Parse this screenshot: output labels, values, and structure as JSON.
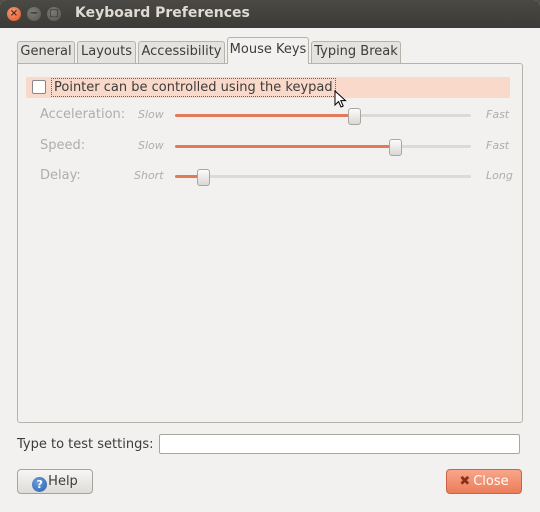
{
  "window": {
    "title": "Keyboard Preferences",
    "close_glyph": "×",
    "minimize_glyph": "−",
    "maximize_glyph": "□"
  },
  "tabs": [
    {
      "label": "General"
    },
    {
      "label": "Layouts"
    },
    {
      "label": "Accessibility"
    },
    {
      "label": "Mouse Keys",
      "active": true
    },
    {
      "label": "Typing Break"
    }
  ],
  "mouse_keys": {
    "enable_label": "Pointer can be controlled using the keypad",
    "enable_checked": false,
    "sliders": [
      {
        "label": "Acceleration:",
        "min_label": "Slow",
        "max_label": "Fast",
        "value": 0.6
      },
      {
        "label": "Speed:",
        "min_label": "Slow",
        "max_label": "Fast",
        "value": 0.74
      },
      {
        "label": "Delay:",
        "min_label": "Short",
        "max_label": "Long",
        "value": 0.09
      }
    ]
  },
  "test": {
    "label": "Type to test settings:",
    "value": ""
  },
  "buttons": {
    "help_label": "Help",
    "close_label": "Close"
  },
  "colors": {
    "accent": "#e1795a",
    "highlight": "#f9d9ca",
    "titlebar": "#3c3b37"
  }
}
